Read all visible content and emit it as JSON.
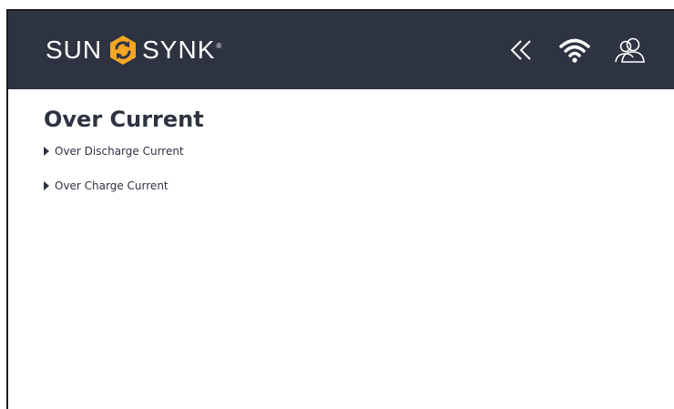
{
  "header": {
    "logo_left": "SUN",
    "logo_right": "SYNK",
    "logo_reg": "®",
    "brand_color": "#2d3341",
    "logo_accent": "#f5a623",
    "icons": [
      "back-icon",
      "wifi-icon",
      "users-icon"
    ]
  },
  "page": {
    "title": "Over Current",
    "items": [
      {
        "label": "Over Discharge Current"
      },
      {
        "label": "Over Charge Current"
      }
    ]
  }
}
